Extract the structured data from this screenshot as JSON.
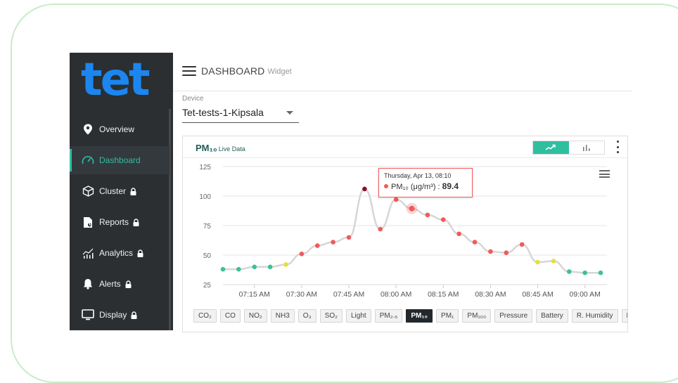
{
  "brand": {
    "logo_text": "tet",
    "accent": "#2fbfa0"
  },
  "sidebar": {
    "items": [
      {
        "label": "Overview",
        "icon": "map-pin-icon",
        "locked": false,
        "active": false
      },
      {
        "label": "Dashboard",
        "icon": "speedometer-icon",
        "locked": false,
        "active": true
      },
      {
        "label": "Cluster",
        "icon": "cube-network-icon",
        "locked": true,
        "active": false
      },
      {
        "label": "Reports",
        "icon": "report-file-icon",
        "locked": true,
        "active": false
      },
      {
        "label": "Analytics",
        "icon": "analytics-icon",
        "locked": true,
        "active": false
      },
      {
        "label": "Alerts",
        "icon": "bell-icon",
        "locked": true,
        "active": false
      },
      {
        "label": "Display",
        "icon": "monitor-icon",
        "locked": true,
        "active": false
      }
    ]
  },
  "header": {
    "title": "DASHBOARD",
    "subtitle": "Widget"
  },
  "device": {
    "label": "Device",
    "value": "Tet-tests-1-Kipsala"
  },
  "widget": {
    "title": "PM₁₀",
    "title_suffix": "Live Data",
    "active_view": "line",
    "chips": [
      "CO₂",
      "CO",
      "NO₂",
      "NH3",
      "O₃",
      "SO₂",
      "Light",
      "PM₂.₅",
      "PM₁₀",
      "PM₁",
      "PM₁₀₀",
      "Pressure",
      "Battery",
      "R. Humidity",
      "Leq"
    ],
    "active_chip": "PM₁₀"
  },
  "tooltip": {
    "date": "Thursday, Apr 13, 08:10",
    "series": "PM₁₀ (μg/m³)",
    "sep": " : ",
    "value": "89.4"
  },
  "chart_data": {
    "type": "line",
    "ylim": [
      25,
      125
    ],
    "yticks": [
      25,
      50,
      75,
      100,
      125
    ],
    "xlim": [
      "07:05",
      "09:07"
    ],
    "xticks": [
      "07:15 AM",
      "07:30 AM",
      "07:45 AM",
      "08:00 AM",
      "08:15 AM",
      "08:30 AM",
      "08:45 AM",
      "09:00 AM"
    ],
    "grid": true,
    "series": [
      {
        "x": [
          "07:05",
          "07:10",
          "07:15",
          "07:20",
          "07:25",
          "07:30",
          "07:35",
          "07:40",
          "07:45",
          "07:50",
          "07:55",
          "08:00",
          "08:05",
          "08:10",
          "08:15",
          "08:20",
          "08:25",
          "08:30",
          "08:35",
          "08:40",
          "08:45",
          "08:50",
          "08:55",
          "09:00",
          "09:05"
        ],
        "values": [
          38,
          38,
          40,
          40,
          42,
          51,
          58,
          61,
          65,
          106,
          72,
          97,
          89.4,
          84,
          80,
          68,
          61,
          53,
          52,
          59,
          44,
          45,
          36,
          35,
          35
        ],
        "point_colors": [
          "#3cc38e",
          "#3cc38e",
          "#3cc38e",
          "#3cc38e",
          "#e8df3a",
          "#f25a5a",
          "#f25a5a",
          "#f25a5a",
          "#f25a5a",
          "#8e0c2b",
          "#f25a5a",
          "#f25a5a",
          "#f25a5a",
          "#f25a5a",
          "#f25a5a",
          "#f25a5a",
          "#f25a5a",
          "#f25a5a",
          "#f25a5a",
          "#f25a5a",
          "#e8df3a",
          "#e8df3a",
          "#3cc38e",
          "#3cc38e",
          "#3cc38e"
        ],
        "highlight_index": 12
      }
    ]
  }
}
